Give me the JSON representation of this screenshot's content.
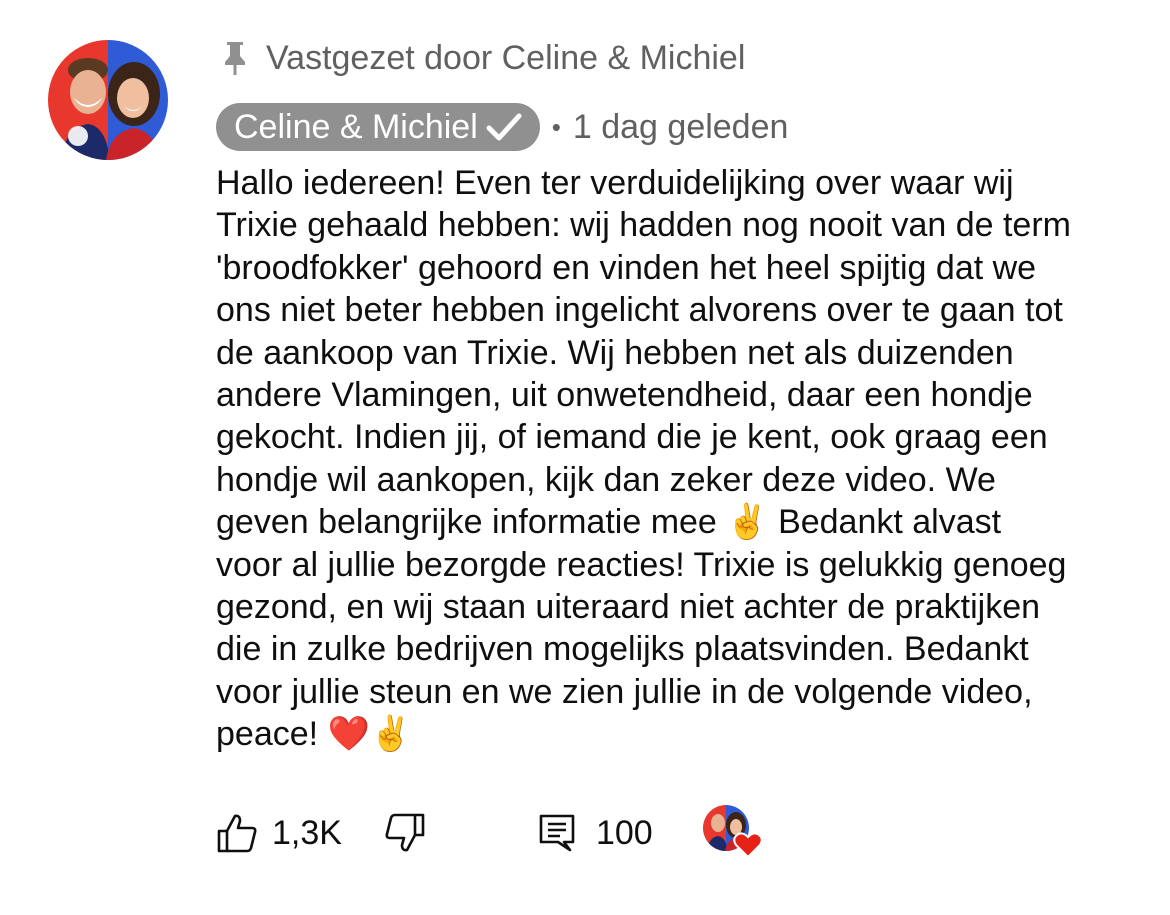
{
  "pinned": {
    "label": "Vastgezet door Celine & Michiel",
    "icon": "pin-icon"
  },
  "author": {
    "name": "Celine & Michiel",
    "verified": true,
    "verified_icon": "checkmark-icon",
    "chip_color": "#909090"
  },
  "separator": "•",
  "timestamp": "1 dag geleden",
  "body_lines": [
    "Hallo iedereen! Even ter verduidelijking over waar wij",
    "Trixie gehaald hebben: wij hadden nog nooit van de term",
    "'broodfokker' gehoord en vinden het heel spijtig dat we",
    "ons niet beter hebben ingelicht alvorens over te gaan tot",
    "de aankoop van Trixie. Wij hebben net als duizenden",
    "andere Vlamingen, uit onwetendheid, daar een hondje",
    "gekocht. Indien jij, of iemand die je kent, ook graag een",
    "hondje wil aankopen, kijk dan zeker deze video. We",
    "geven belangrijke informatie mee ✌️  Bedankt alvast",
    "voor al jullie bezorgde reacties! Trixie is gelukkig genoeg",
    "gezond, en wij staan uiteraard niet achter de praktijken",
    "die in zulke bedrijven mogelijks plaatsvinden. Bedankt",
    "voor jullie steun en we zien jullie in de volgende video,",
    "peace! ❤️✌️"
  ],
  "actions": {
    "like_count": "1,3K",
    "reply_count": "100",
    "like_icon": "thumbs-up-icon",
    "dislike_icon": "thumbs-down-icon",
    "reply_icon": "comment-icon",
    "creator_heart_icon": "creator-heart-icon"
  },
  "colors": {
    "text": "#0f0f0f",
    "secondary": "#606060",
    "heart": "#e62117",
    "avatar_red": "#e8372c",
    "avatar_blue": "#2f5bd6"
  }
}
